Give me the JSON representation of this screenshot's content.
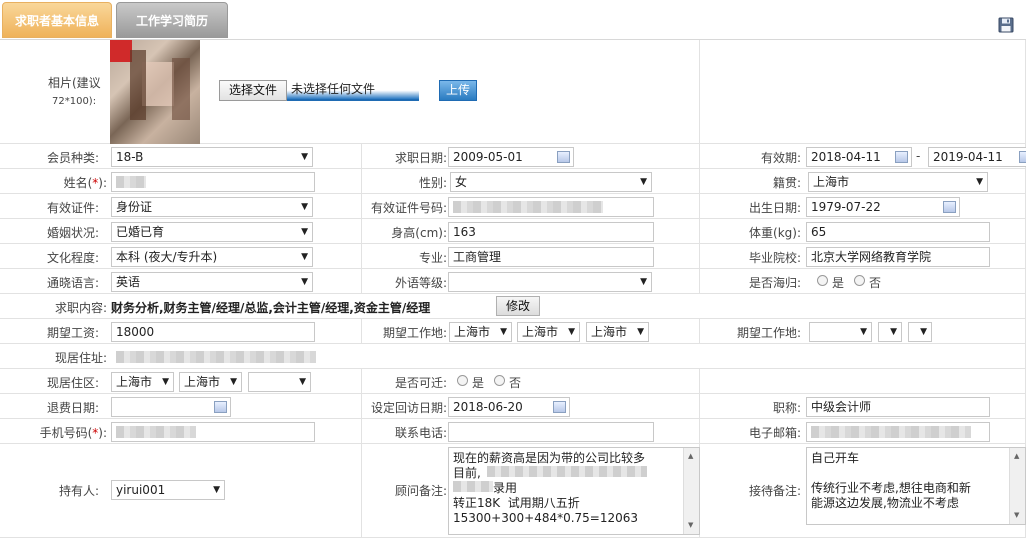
{
  "tabs": [
    {
      "label": "求职者基本信息"
    },
    {
      "label": "工作学习简历"
    }
  ],
  "photo": {
    "label_line1": "相片(建议",
    "label_line2": "72*100):",
    "choose_button": "选择文件",
    "no_file_text": "未选择任何文件",
    "upload_button": "上传"
  },
  "row1": {
    "member_type_label": "会员种类:",
    "member_type_value": "18-B",
    "job_date_label": "求职日期:",
    "job_date_value": "2009-05-01",
    "valid_label": "有效期:",
    "valid_from": "2018-04-11",
    "valid_sep": "-",
    "valid_to": "2019-04-11"
  },
  "row2": {
    "name_label": "姓名(",
    "name_req": "*",
    "name_label_end": "):",
    "gender_label": "性别:",
    "gender_value": "女",
    "native_label": "籍贯:",
    "native_value": "上海市"
  },
  "row3": {
    "id_type_label": "有效证件:",
    "id_type_value": "身份证",
    "id_num_label": "有效证件号码:",
    "birth_label": "出生日期:",
    "birth_value": "1979-07-22"
  },
  "row4": {
    "marital_label": "婚姻状况:",
    "marital_value": "已婚已育",
    "height_label": "身高(cm):",
    "height_value": "163",
    "weight_label": "体重(kg):",
    "weight_value": "65"
  },
  "row5": {
    "edu_label": "文化程度:",
    "edu_value": "本科 (夜大/专升本)",
    "major_label": "专业:",
    "major_value": "工商管理",
    "school_label": "毕业院校:",
    "school_value": "北京大学网络教育学院"
  },
  "row6": {
    "lang_label": "通晓语言:",
    "lang_value": "英语",
    "lang_level_label": "外语等级:",
    "returnee_label": "是否海归:",
    "yes": "是",
    "no": "否"
  },
  "row7": {
    "job_label": "求职内容:",
    "job_value": "财务分析,财务主管/经理/总监,会计主管/经理,资金主管/经理",
    "edit_button": "修改"
  },
  "row8": {
    "salary_label": "期望工资:",
    "salary_value": "18000",
    "place_label": "期望工作地:",
    "place_p": "上海市",
    "place_c": "上海市",
    "place_d": "上海市",
    "place2_label": "期望工作地:"
  },
  "row9": {
    "address_label": "现居住址:"
  },
  "row10": {
    "area_label": "现居住区:",
    "area_p": "上海市",
    "area_c": "上海市",
    "relocate_label": "是否可迁:",
    "yes": "是",
    "no": "否"
  },
  "row11": {
    "refund_label": "退费日期:",
    "callback_label": "设定回访日期:",
    "callback_value": "2018-06-20",
    "title_label": "职称:",
    "title_value": "中级会计师"
  },
  "row12": {
    "mobile_label": "手机号码(",
    "mobile_req": "*",
    "mobile_label_end": "):",
    "phone_label": "联系电话:",
    "email_label": "电子邮箱:"
  },
  "row13": {
    "owner_label": "持有人:",
    "owner_value": "yirui001",
    "advisor_label": "顾问备注:",
    "advisor_lines": [
      "现在的薪资高是因为带的公司比较多",
      "目前,",
      "录用",
      "转正18K  试用期八五折",
      "15300+300+484*0.75=12063"
    ],
    "reception_label": "接待备注:",
    "reception_lines": [
      "自己开车",
      "",
      "传统行业不考虑,想往电商和新",
      "能源这边发展,物流业不考虑"
    ]
  },
  "colors": {
    "accent_tab": "#efb25a",
    "required": "#cc0000",
    "button_blue": "#2a7bc0"
  }
}
